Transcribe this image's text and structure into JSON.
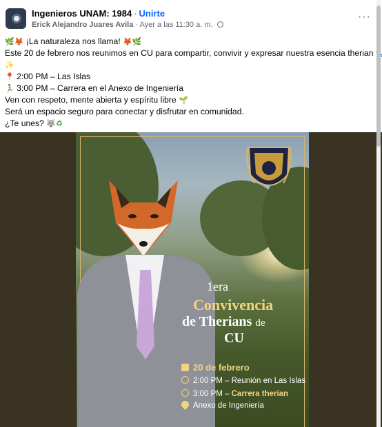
{
  "post": {
    "group_name": "Ingenieros UNAM: 1984",
    "separator": "·",
    "join_label": "Unirte",
    "author": "Erick Alejandro Juares Avila",
    "timestamp": "Ayer a las 11:30 a. m.",
    "more_label": "···",
    "lines": {
      "l1": "¡La naturaleza nos llama!",
      "l2": "Este 20 de febrero nos reunimos en CU para compartir, convivir y expresar nuestra esencia therian",
      "l3": "2:00 PM – Las Islas",
      "l4": "3:00 PM – Carrera en el Anexo de Ingeniería",
      "l5": "Ven con respeto, mente abierta y espíritu libre",
      "l6": "Será un espacio seguro para conectar y disfrutar en comunidad.",
      "l7": "¿Te unes?"
    },
    "emojis": {
      "leaf": "🌿",
      "fox": "🦊",
      "paw": "🐾",
      "sparkles": "✨",
      "pin": "📍",
      "runner": "🏃",
      "seedling": "🌱",
      "wolf": "🐺",
      "recycle": "♻"
    }
  },
  "poster": {
    "title_line1": "1era",
    "title_line2": "Convivencia",
    "title_line3_a": "de Therians",
    "title_line3_b": "de",
    "title_line4": "CU",
    "date": "20 de febrero",
    "time1": "2:00 PM – Reunión en Las Islas",
    "time2_time": "3:00 PM –",
    "time2_event": "Carrera therian",
    "place": "Anexo de Ingeniería"
  }
}
